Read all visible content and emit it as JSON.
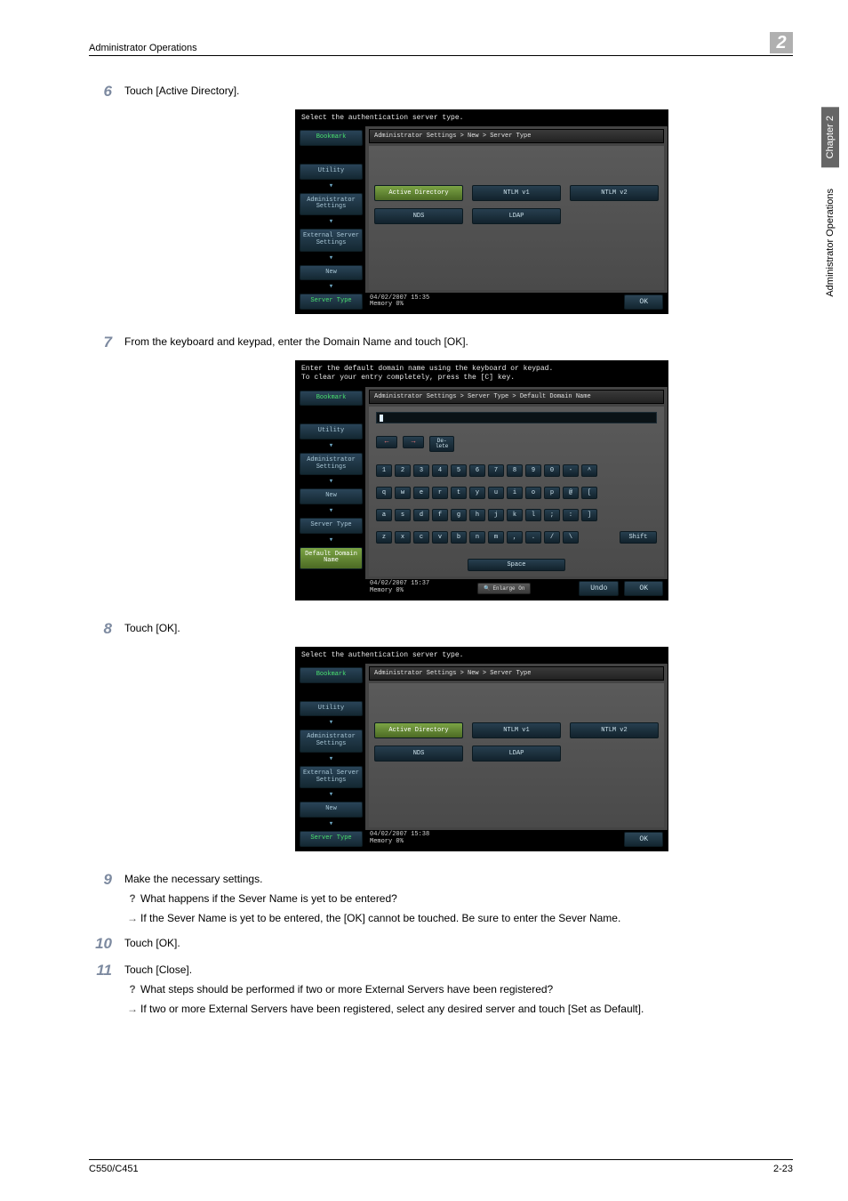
{
  "header": {
    "title": "Administrator Operations",
    "chapter_num": "2"
  },
  "side": {
    "chapter": "Chapter 2",
    "ops": "Administrator Operations"
  },
  "steps": {
    "s6": {
      "num": "6",
      "text": "Touch [Active Directory]."
    },
    "s7": {
      "num": "7",
      "text": "From the keyboard and keypad, enter the Domain Name and touch [OK]."
    },
    "s8": {
      "num": "8",
      "text": "Touch [OK]."
    },
    "s9": {
      "num": "9",
      "text": "Make the necessary settings.",
      "q": "What happens if the Sever Name is yet to be entered?",
      "a": "If the Sever Name is yet to be entered, the [OK] cannot be touched. Be sure to enter the Sever Name."
    },
    "s10": {
      "num": "10",
      "text": "Touch [OK]."
    },
    "s11": {
      "num": "11",
      "text": "Touch [Close].",
      "q": "What steps should be performed if two or more External Servers have been registered?",
      "a": "If two or more External Servers have been registered, select any desired server and touch [Set as Default]."
    }
  },
  "shot1": {
    "prompt": "Select the authentication server type.",
    "breadcrumb": "Administrator Settings > New > Server Type",
    "side": {
      "bookmark": "Bookmark",
      "utility": "Utility",
      "admin": "Administrator Settings",
      "ext": "External Server Settings",
      "new": "New",
      "server_type": "Server Type"
    },
    "opts": {
      "ad": "Active Directory",
      "ntlm1": "NTLM v1",
      "ntlm2": "NTLM v2",
      "nds": "NDS",
      "ldap": "LDAP"
    },
    "footer": {
      "dt": "04/02/2007   15:35",
      "mem": "Memory        0%",
      "ok": "OK"
    }
  },
  "shot2": {
    "prompt1": "Enter the default domain name using the keyboard or keypad.",
    "prompt2": "To clear your entry completely, press the [C] key.",
    "breadcrumb": "Administrator Settings > Server Type > Default Domain Name",
    "side": {
      "bookmark": "Bookmark",
      "utility": "Utility",
      "admin": "Administrator Settings",
      "new": "New",
      "server_type": "Server Type",
      "ddn": "Default Domain Name"
    },
    "kb": {
      "del": "De-\nlete",
      "row1": [
        "1",
        "2",
        "3",
        "4",
        "5",
        "6",
        "7",
        "8",
        "9",
        "0",
        "-",
        "^"
      ],
      "row2": [
        "q",
        "w",
        "e",
        "r",
        "t",
        "y",
        "u",
        "i",
        "o",
        "p",
        "@",
        "["
      ],
      "row3": [
        "a",
        "s",
        "d",
        "f",
        "g",
        "h",
        "j",
        "k",
        "l",
        ";",
        ":",
        "]"
      ],
      "row4": [
        "z",
        "x",
        "c",
        "v",
        "b",
        "n",
        "m",
        ",",
        ".",
        "/",
        "\\"
      ],
      "shift": "Shift",
      "space": "Space"
    },
    "footer": {
      "dt": "04/02/2007   15:37",
      "mem": "Memory        0%",
      "enlarge": "Enlarge On",
      "undo": "Undo",
      "ok": "OK"
    }
  },
  "shot3": {
    "prompt": "Select the authentication server type.",
    "breadcrumb": "Administrator Settings > New > Server Type",
    "side": {
      "bookmark": "Bookmark",
      "utility": "Utility",
      "admin": "Administrator Settings",
      "ext": "External Server Settings",
      "new": "New",
      "server_type": "Server Type"
    },
    "opts": {
      "ad": "Active Directory",
      "ntlm1": "NTLM v1",
      "ntlm2": "NTLM v2",
      "nds": "NDS",
      "ldap": "LDAP"
    },
    "footer": {
      "dt": "04/02/2007   15:38",
      "mem": "Memory        0%",
      "ok": "OK"
    }
  },
  "footer": {
    "model": "C550/C451",
    "page": "2-23"
  }
}
